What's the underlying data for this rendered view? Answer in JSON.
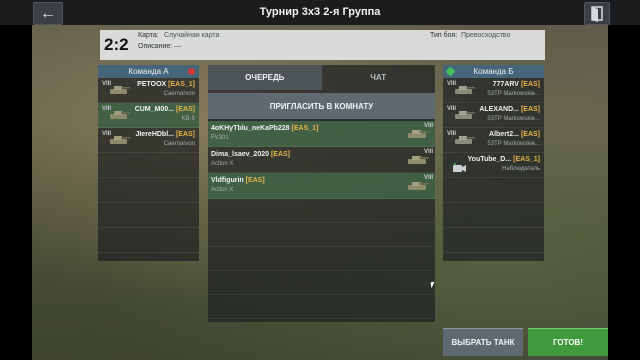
{
  "header": {
    "title": "Турнир 3х3 2-я Группа"
  },
  "info": {
    "score": "2:2",
    "map_label": "Карта:",
    "map_value": "Случайная карта",
    "desc_label": "Описание:",
    "desc_value": "—",
    "battle_type_label": "Тип боя:",
    "battle_type_value": "Превосходство"
  },
  "team_a": {
    "title": "Команда А",
    "players": [
      {
        "tier": "VIII",
        "name": "PETOOX",
        "clan": "[EAS_1]",
        "tank": "Caernarvon"
      },
      {
        "tier": "VIII",
        "name": "CUM_M00...",
        "clan": "[EAS]",
        "tank": "KB-5"
      },
      {
        "tier": "VIII",
        "name": "JIereHDbl...",
        "clan": "[EAS]",
        "tank": "Caernarvon"
      }
    ]
  },
  "team_b": {
    "title": "Команда Б",
    "players": [
      {
        "tier": "VIII",
        "name": "777ARV",
        "clan": "[EAS]",
        "tank": "53TP Markowskie..."
      },
      {
        "tier": "VIII",
        "name": "ALEXAND...",
        "clan": "[EAS]",
        "tank": "53TP Markowskie..."
      },
      {
        "tier": "VIII",
        "name": "Albert2...",
        "clan": "[EAS]",
        "tank": "53TP Markowskie..."
      },
      {
        "tier": "",
        "name": "YouTube_D...",
        "clan": "[EAS_1]",
        "tank": "Наблюдатель"
      }
    ]
  },
  "center": {
    "tab_queue": "ОЧЕРЕДЬ",
    "tab_chat": "ЧАТ",
    "invite": "ПРИГЛАСИТЬ В КОМНАТУ",
    "queue": [
      {
        "name": "4oKHyTblu_neKaPb228",
        "clan": "[EAS_1]",
        "tank": "FV301",
        "tier": "VIII"
      },
      {
        "name": "Dima_lsaev_2020",
        "clan": "[EAS]",
        "tank": "Action X",
        "tier": "VIII"
      },
      {
        "name": "Vldfigurin",
        "clan": "[EAS]",
        "tank": "Action X",
        "tier": "VIII"
      }
    ]
  },
  "buttons": {
    "choose_tank": "ВЫБРАТЬ ТАНК",
    "ready": "ГОТОВ!"
  },
  "colors": {
    "clan": "#e8b54a",
    "ready": "#3e9a3c",
    "team_a_mark": "#d23a3a",
    "team_b_mark": "#3fbf5a",
    "mine_row": "#4b8255"
  }
}
